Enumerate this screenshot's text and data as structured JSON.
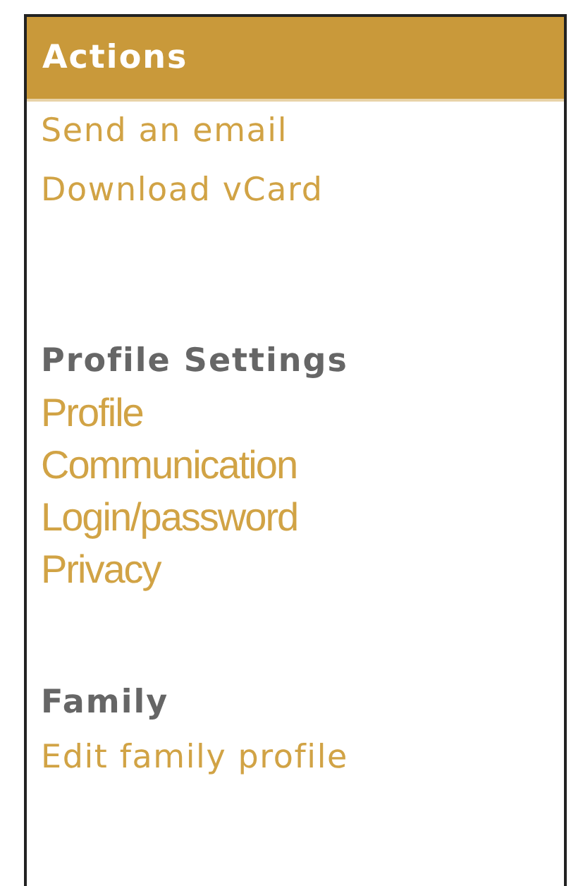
{
  "panel": {
    "title": "Actions"
  },
  "sections": [
    {
      "kind": "wide",
      "links": [
        "Send an email",
        "Download vCard"
      ]
    },
    {
      "kind": "narrow",
      "heading": "Profile Settings",
      "links": [
        "Profile",
        "Communication",
        "Login/password",
        "Privacy"
      ]
    },
    {
      "kind": "wide",
      "heading": "Family",
      "links": [
        "Edit family profile"
      ]
    }
  ]
}
